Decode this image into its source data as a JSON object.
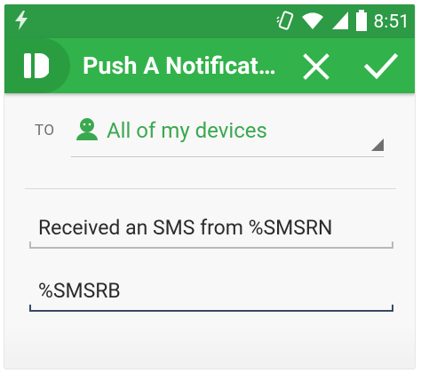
{
  "status_bar": {
    "time": "8:51",
    "icons": [
      "flash-icon",
      "vibrate-icon",
      "wifi-icon",
      "signal-icon",
      "battery-icon"
    ]
  },
  "action_bar": {
    "app_icon": "pushbullet-logo-icon",
    "title": "Push A Notificati…",
    "close_icon": "close-icon",
    "confirm_icon": "check-icon"
  },
  "form": {
    "to_label": "TO",
    "device_selector": {
      "icon": "android-icon",
      "value": "All of my devices"
    },
    "title_field": {
      "value": "Received an SMS from %SMSRN"
    },
    "body_field": {
      "value": "%SMSRB"
    }
  },
  "colors": {
    "status_bar": "#2d9a45",
    "action_bar": "#32b24a",
    "accent_green": "#3aa84f",
    "focused_underline": "#3a4a63"
  }
}
